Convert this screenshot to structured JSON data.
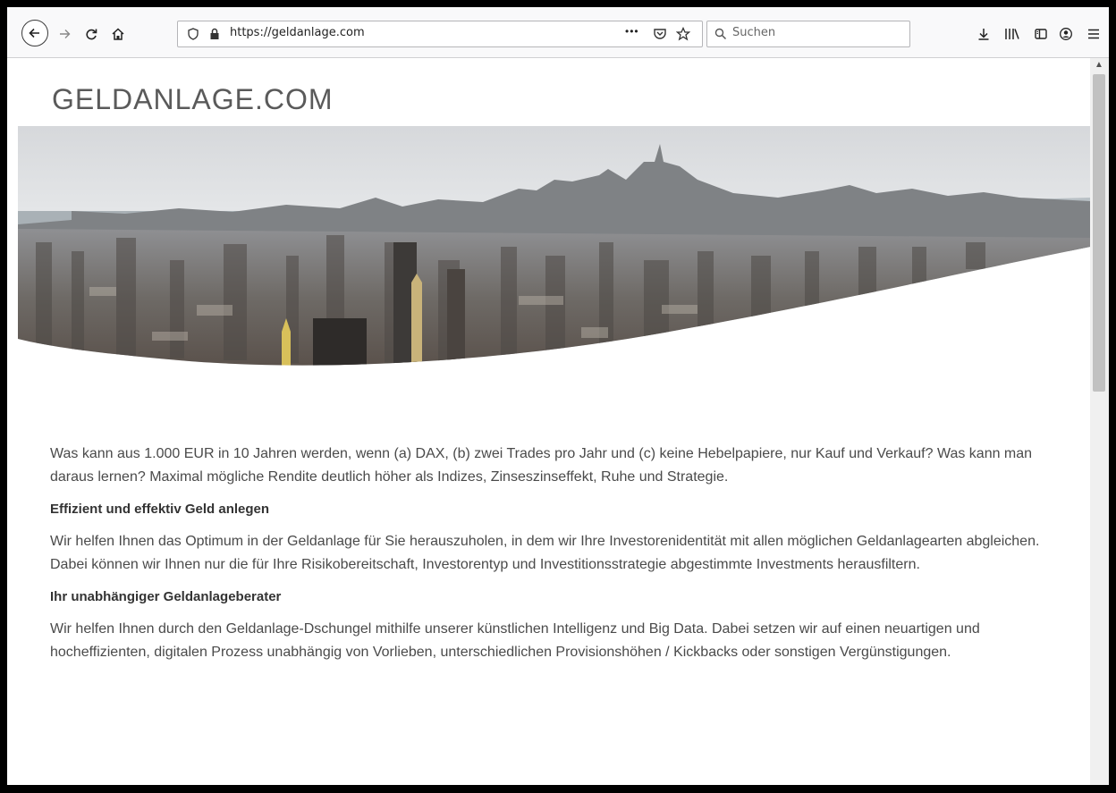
{
  "browser": {
    "url": "https://geldanlage.com",
    "search_placeholder": "Suchen",
    "more_label": "•••"
  },
  "site": {
    "title": "GELDANLAGE.COM"
  },
  "content": {
    "intro": "Was kann aus 1.000 EUR in 10 Jahren werden, wenn (a) DAX, (b) zwei Trades pro Jahr und (c) keine Hebelpapiere, nur Kauf und Verkauf? Was kann man daraus lernen? Maximal mögliche Rendite deutlich höher als Indizes, Zinseszinseffekt, Ruhe und Strategie.",
    "heading1": "Effizient und effektiv Geld anlegen",
    "para1": "Wir helfen Ihnen das Optimum in der Geldanlage für Sie herauszuholen, in dem wir Ihre Investorenidentität mit allen möglichen Geldanlagearten abgleichen. Dabei können wir Ihnen nur die für Ihre Risikobereitschaft, Investorentyp und Investitionsstrategie abgestimmte Investments herausfiltern.",
    "heading2": "Ihr unabhängiger Geldanlageberater",
    "para2": "Wir helfen Ihnen durch den Geldanlage-Dschungel mithilfe unserer künstlichen Intelligenz und Big Data. Dabei setzen wir auf einen neuartigen und hocheffizienten, digitalen Prozess unabhängig von Vorlieben, unterschiedlichen Provisionshöhen / Kickbacks oder sonstigen Vergünstigungen."
  }
}
